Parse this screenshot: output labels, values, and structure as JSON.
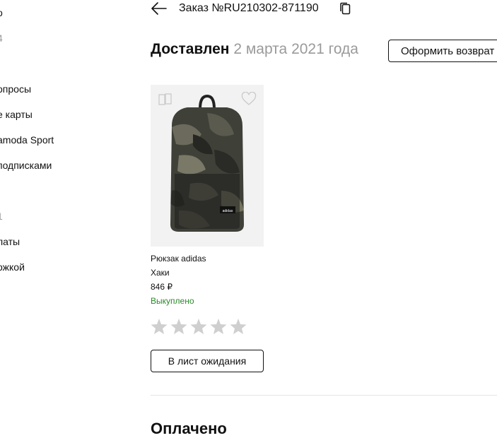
{
  "sidebar": {
    "items": [
      {
        "label": "о",
        "muted": false
      },
      {
        "label": "4",
        "muted": true
      },
      {
        "label": "опросы",
        "muted": false
      },
      {
        "label": "е карты",
        "muted": false
      },
      {
        "label": "amoda Sport",
        "muted": false
      },
      {
        "label": " подписками",
        "muted": false
      },
      {
        "label": "1",
        "muted": true
      },
      {
        "label": "латы",
        "muted": false
      },
      {
        "label": "ожкой",
        "muted": false
      }
    ]
  },
  "header": {
    "back_icon": "arrow-left-icon",
    "order_title": "Заказ №RU210302-871190",
    "copy_icon": "copy-icon"
  },
  "status": {
    "state": "Доставлен",
    "date": "2 марта 2021 года",
    "return_button": "Оформить возврат"
  },
  "product": {
    "name": "Рюкзак adidas",
    "color": "Хаки",
    "price": "846 ₽",
    "purchase_status": "Выкуплено",
    "image_brand_text": "adidas",
    "compare_icon": "compare-icon",
    "favorite_icon": "heart-icon",
    "rating": {
      "stars": 5,
      "value": 0
    },
    "waitlist_button": "В лист ожидания"
  },
  "next_section": {
    "title": "Оплачено"
  },
  "colors": {
    "status_ok": "#2a8a2a",
    "muted_text": "#9a9a9a",
    "star": "#cfcfcf"
  }
}
